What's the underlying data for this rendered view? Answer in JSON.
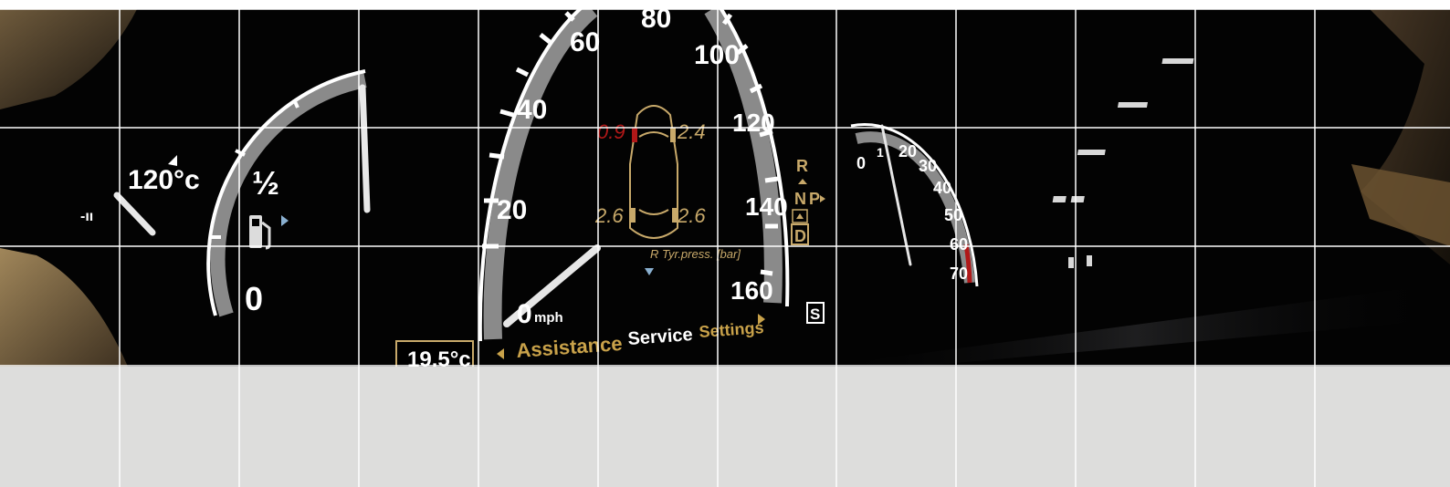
{
  "dashboard": {
    "left_gauge": {
      "temp_label": "120°c",
      "temp_low_label": "-ıı",
      "fuel_half": "½",
      "fuel_empty": "0"
    },
    "speedometer": {
      "ticks": [
        "20",
        "40",
        "60",
        "80",
        "100",
        "120",
        "140",
        "160"
      ],
      "zero": "0",
      "unit": "mph"
    },
    "tyre_pressure": {
      "front_left": "0.9",
      "front_right": "2.4",
      "rear_left": "2.6",
      "rear_right": "2.6",
      "caption": "R  Tyr.press. [bar]"
    },
    "gear_selector": {
      "r": "R",
      "n": "N",
      "p": "P",
      "d": "D",
      "s": "S"
    },
    "menu": {
      "assistance": "Assistance",
      "service": "Service",
      "settings": "Settings"
    },
    "outside_temp": "19.5°c",
    "tachometer": {
      "ticks": [
        "0",
        "1",
        "20",
        "30",
        "40",
        "50",
        "60",
        "70"
      ]
    }
  },
  "colors": {
    "dial_white": "#ffffff",
    "menu_gold": "#c9a24a",
    "warning_red": "#b01818",
    "tyre_tan": "#c8a96a",
    "panel_grey": "#dddddc",
    "grid_white": "#ffffff"
  }
}
